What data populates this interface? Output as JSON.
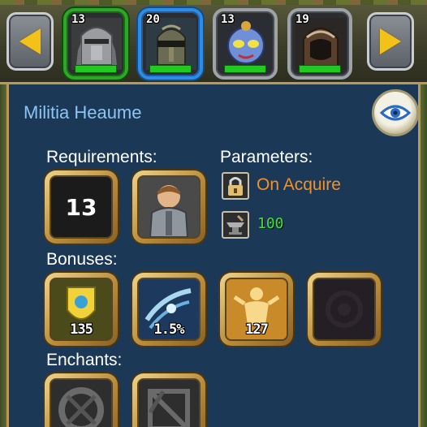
{
  "equipment_strip": {
    "slots": [
      {
        "level": "13",
        "name": "stone-helmet",
        "state": "selected-green"
      },
      {
        "level": "20",
        "name": "knight-helmet",
        "state": "selected-blue"
      },
      {
        "level": "13",
        "name": "blue-mask",
        "state": "normal"
      },
      {
        "level": "19",
        "name": "leather-hood",
        "state": "normal"
      }
    ]
  },
  "item": {
    "title": "Militia Heaume"
  },
  "requirements": {
    "label": "Requirements:",
    "level": "13"
  },
  "parameters": {
    "label": "Parameters:",
    "binding": "On Acquire",
    "value": "100"
  },
  "bonuses": {
    "label": "Bonuses:",
    "items": [
      {
        "value": "135",
        "icon": "shield-bonus-icon"
      },
      {
        "value": "1.5%",
        "icon": "speed-bonus-icon"
      },
      {
        "value": "127",
        "icon": "strength-bonus-icon"
      },
      {
        "value": "",
        "icon": "empty-slot"
      }
    ]
  },
  "enchants": {
    "label": "Enchants:"
  },
  "colors": {
    "panel": "#1c3857",
    "title": "#8cc4f2",
    "binding": "#f0912a",
    "value": "#3be23b",
    "gold_frame": "#b88b3a"
  }
}
